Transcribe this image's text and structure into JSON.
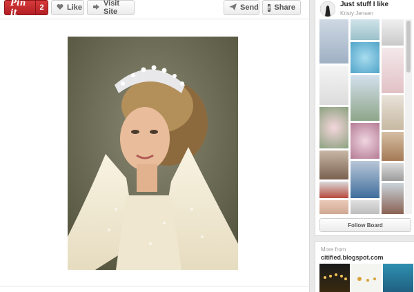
{
  "toolbar": {
    "pinit_label": "Pin it",
    "pinit_count": "2",
    "like_label": "Like",
    "visit_label": "Visit Site",
    "send_label": "Send",
    "share_label": "Share"
  },
  "icons": {
    "like": "heart-icon",
    "visit": "external-link-icon",
    "send": "paper-plane-icon",
    "share": "facebook-icon"
  },
  "pin": {
    "image_subject": "portrait-photo"
  },
  "board": {
    "title": "Just stuff I like",
    "owner": "Kristy Jensen",
    "follow_label": "Follow Board"
  },
  "more": {
    "label": "More from",
    "source": "citified.blogspot.com"
  },
  "colors": {
    "pinit_red": "#c42a2f",
    "background": "#e9e9e9"
  }
}
